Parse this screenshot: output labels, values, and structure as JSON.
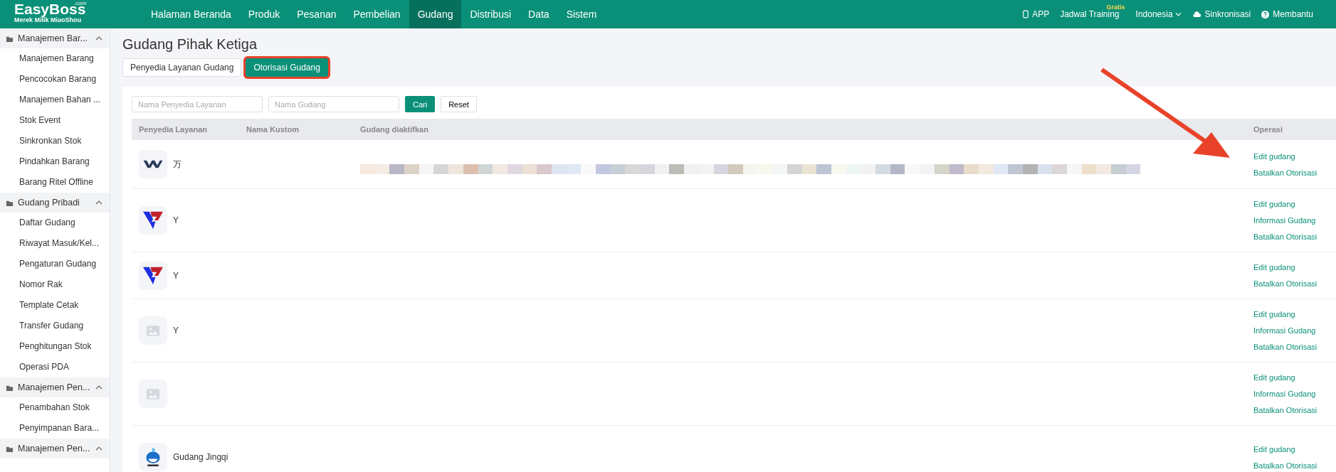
{
  "topbar": {
    "logo": "EasyBoss",
    "logo_suffix": ".com",
    "logo_tagline": "Merek Milik MiaoShou",
    "nav": [
      {
        "label": "Halaman Beranda",
        "selected": false
      },
      {
        "label": "Produk",
        "selected": false
      },
      {
        "label": "Pesanan",
        "selected": false
      },
      {
        "label": "Pembelian",
        "selected": false
      },
      {
        "label": "Gudang",
        "selected": true
      },
      {
        "label": "Distribusi",
        "selected": false
      },
      {
        "label": "Data",
        "selected": false
      },
      {
        "label": "Sistem",
        "selected": false
      }
    ],
    "app": "APP",
    "training": "Jadwal Training",
    "training_badge": "Gratis",
    "language": "Indonesia",
    "sync": "Sinkronisasi",
    "help": "Membantu"
  },
  "sidebar": [
    {
      "label": "Manajemen Bar...",
      "expanded": true,
      "children": [
        {
          "label": "Manajemen Barang"
        },
        {
          "label": "Pencocokan Barang"
        },
        {
          "label": "Manajemen Bahan ..."
        },
        {
          "label": "Stok Event"
        },
        {
          "label": "Sinkronkan Stok"
        },
        {
          "label": "Pindahkan Barang"
        },
        {
          "label": "Barang Ritel Offline"
        }
      ]
    },
    {
      "label": "Gudang Pribadi",
      "expanded": true,
      "children": [
        {
          "label": "Daftar Gudang"
        },
        {
          "label": "Riwayat Masuk/Kel..."
        },
        {
          "label": "Pengaturan Gudang"
        },
        {
          "label": "Nomor Rak"
        },
        {
          "label": "Template Cetak"
        },
        {
          "label": "Transfer Gudang"
        },
        {
          "label": "Penghitungan Stok"
        },
        {
          "label": "Operasi PDA"
        }
      ]
    },
    {
      "label": "Manajemen Pen...",
      "expanded": true,
      "children": [
        {
          "label": "Penambahan Stok"
        },
        {
          "label": "Penyimpanan Bara..."
        }
      ]
    },
    {
      "label": "Manajemen Pen...",
      "expanded": true
    }
  ],
  "page_title": "Gudang Pihak Ketiga",
  "tabs": [
    {
      "label": "Penyedia Layanan Gudang",
      "selected": false
    },
    {
      "label": "Otorisasi Gudang",
      "selected": true
    }
  ],
  "filters": {
    "provider": {
      "placeholder": "Nama Penyedia Layanan"
    },
    "warehouse": {
      "placeholder": "Nama Gudang"
    },
    "search": "Cari",
    "reset": "Reset"
  },
  "table": {
    "columns": [
      "Penyedia Layanan",
      "Nama Kustom",
      "Gudang diaktifkan",
      "Operasi"
    ],
    "rows": [
      {
        "kind": "w",
        "name": "万",
        "operations": [
          "Edit gudang",
          "Batalkan Otorisasi"
        ]
      },
      {
        "kind": "v",
        "name": "Y",
        "operations": [
          "Edit gudang",
          "Informasi Gudang",
          "Batalkan Otorisasi"
        ]
      },
      {
        "kind": "v",
        "name": "Y",
        "operations": [
          "Edit gudang",
          "Batalkan Otorisasi"
        ]
      },
      {
        "kind": "placeholder",
        "name": "Y",
        "operations": [
          "Edit gudang",
          "Informasi Gudang",
          "Batalkan Otorisasi"
        ]
      },
      {
        "kind": "placeholder",
        "operations": [
          "Edit gudang",
          "Informasi Gudang",
          "Batalkan Otorisasi"
        ]
      },
      {
        "kind": "whale",
        "name": "Gudang Jingqi",
        "operations": [
          "Edit gudang",
          "Batalkan Otorisasi"
        ]
      }
    ]
  }
}
